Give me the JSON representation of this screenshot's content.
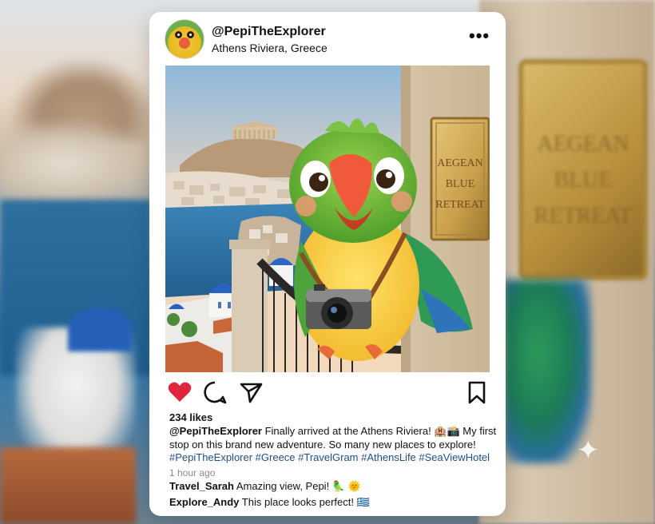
{
  "background": {
    "plaque_lines": [
      "AEGEAN",
      "BLUE",
      "RETREAT"
    ]
  },
  "post": {
    "username": "@PepiTheExplorer",
    "location": "Athens Riviera, Greece",
    "more_icon": "more-dots-icon",
    "photo": {
      "plaque_lines": [
        "AEGEAN",
        "BLUE",
        "RETREAT"
      ]
    },
    "actions": {
      "like_icon": "heart-icon",
      "comment_icon": "comment-bubble-icon",
      "share_icon": "paper-plane-icon",
      "save_icon": "bookmark-icon",
      "like_color": "#e0243c"
    },
    "likes": "234 likes",
    "caption": {
      "username": "@PepiTheExplorer",
      "text": " Finally arrived at the Athens Riviera! 🏨📸 My first stop on this brand new adventure. So many new places to explore!",
      "hashtags": "#PepiTheExplorer #Greece #TravelGram #AthensLife #SeaViewHotel"
    },
    "time": "1 hour ago",
    "comments": [
      {
        "username": "Travel_Sarah",
        "text": " Amazing view, Pepi! 🦜 🌞"
      },
      {
        "username": "Explore_Andy",
        "text": " This place looks perfect! 🇬🇷"
      }
    ]
  },
  "colors": {
    "hashtag": "#1f4d8a",
    "like_red": "#e0243c"
  }
}
